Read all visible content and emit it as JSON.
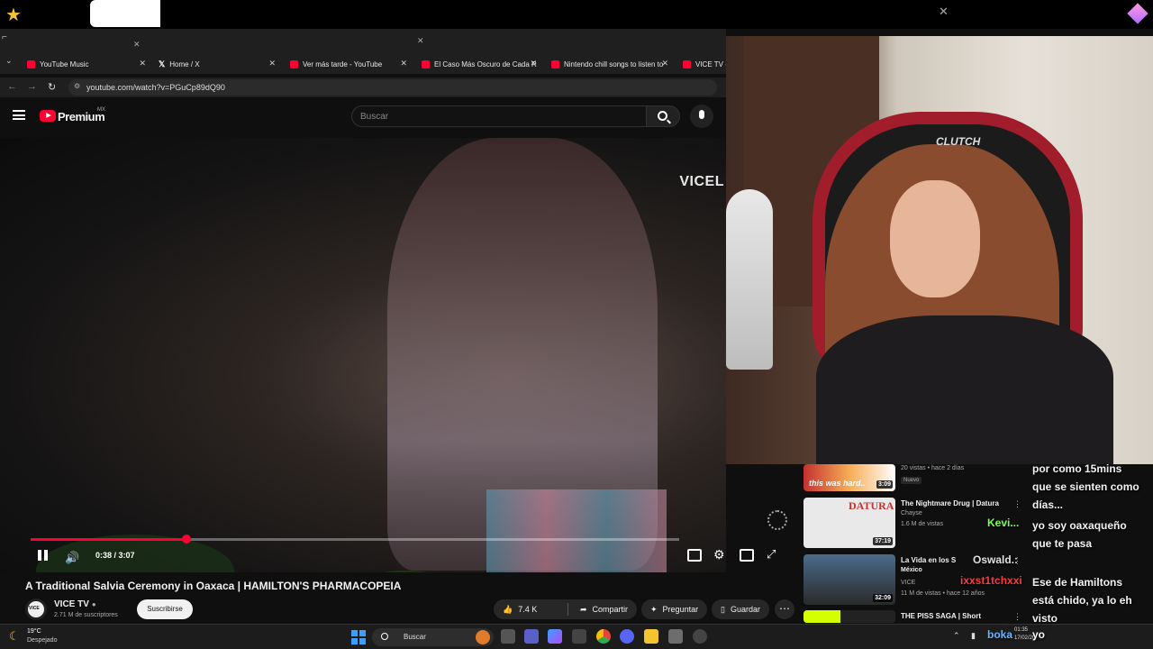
{
  "browser": {
    "tabs": [
      {
        "label": "YouTube Music",
        "favicon": "youtube-music-icon"
      },
      {
        "label": "Home / X",
        "favicon": "x-icon"
      },
      {
        "label": "Ver más tarde - YouTube",
        "favicon": "youtube-icon"
      },
      {
        "label": "El Caso Más Oscuro de Cada Re",
        "favicon": "youtube-icon"
      },
      {
        "label": "Nintendo chill songs to listen to",
        "favicon": "youtube-icon"
      },
      {
        "label": "VICE TV - Y",
        "favicon": "youtube-icon"
      }
    ],
    "url": "youtube.com/watch?v=PGuCp89dQ90"
  },
  "youtube": {
    "brand": "Premium",
    "region": "MX",
    "search_placeholder": "Buscar"
  },
  "video": {
    "watermark": "VICEL",
    "time_display": "0:38 / 3:07",
    "progress_fraction": 0.24,
    "title": "A Traditional Salvia Ceremony in Oaxaca | HAMILTON'S PHARMACOPEIA",
    "channel": "VICE TV",
    "channel_avatar_text": "VICE",
    "subscribers": "2.71 M de suscriptores",
    "subscribe_label": "Suscribirse",
    "likes": "7.4 K",
    "share_label": "Compartir",
    "ask_label": "Preguntar",
    "save_label": "Guardar"
  },
  "webcam": {
    "chair_brand": "CLUTCH"
  },
  "recommended": [
    {
      "thumb_text": "this was hard..",
      "duration": "3:09",
      "meta1": "20 vistas • hace 2 días",
      "badge": "Nuevo"
    },
    {
      "thumb_text": "DATURA",
      "duration": "37:19",
      "title": "The Nightmare Drug | Datura",
      "channel": "Chayse",
      "meta": "1.6 M de vistas"
    },
    {
      "duration": "32:09",
      "title": "La Vida en los S",
      "channel2": "México",
      "channel": "VICE",
      "meta": "11 M de vistas • hace 12 años"
    },
    {
      "title": "THE PISS SAGA | Short"
    }
  ],
  "chat": {
    "lines": [
      "por como 15mins",
      "que se sienten como",
      "días...",
      "yo soy oaxaqueño",
      "que te pasa",
      "Ese de Hamiltons",
      "está chido, ya lo eh",
      "visto"
    ],
    "users": [
      {
        "name": "Kevi...",
        "color": "#7dff5a"
      },
      {
        "name": "Oswald.:",
        "color": "#e0e0e0"
      },
      {
        "name": "ixxst1tchxxi",
        "color": "#ff3b3b"
      },
      {
        "name": "boka",
        "color": "#6ab7ff"
      }
    ],
    "last_message": "yo"
  },
  "taskbar": {
    "weather_temp": "19°C",
    "weather_desc": "Despejado",
    "search_label": "Buscar",
    "time": "01:35",
    "date": "17/02/20"
  }
}
